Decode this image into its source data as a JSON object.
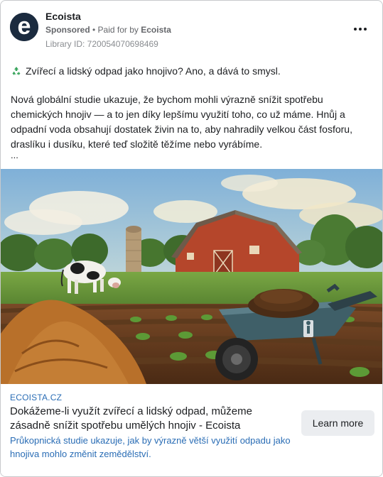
{
  "header": {
    "page_name": "Ecoista",
    "sponsored": "Sponsored",
    "separator": " • ",
    "paid_for_prefix": "Paid for by ",
    "payer": "Ecoista",
    "library_id": "Library ID: 720054070698469",
    "avatar_letter": "e",
    "more_icon": "more-options-icon"
  },
  "post": {
    "headline": "Zvířecí a lidský odpad jako hnojivo? Ano, a dává to smysl.",
    "headline_icon": "recycle-icon",
    "body": "Nová globální studie ukazuje, že bychom mohli výrazně snížit spotřebu chemických hnojiv — a to jen díky lepšímu využití toho, co už máme. Hnůj a odpadní voda obsahují dostatek živin na to, aby nahradily velkou část fosforu, draslíku i dusíku, které teď složitě těžíme nebo vyrábíme.",
    "more": "..."
  },
  "link": {
    "domain": "ECOISTA.CZ",
    "title": "Dokážeme-li využít zvířecí a lidský odpad, můžeme zásadně snížit spotřebu umělých hnojiv - Ecoista",
    "description": "Průkopnická studie ukazuje, jak by výrazně větší využití odpadu jako hnojiva mohlo změnit zemědělství.",
    "cta": "Learn more"
  },
  "colors": {
    "link_blue": "#2a6db5",
    "avatar_bg": "#1b2b3f",
    "button_bg": "#ebedf0"
  }
}
